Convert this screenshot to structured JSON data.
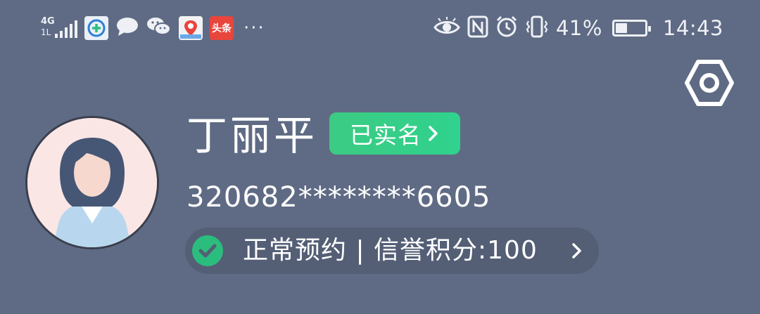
{
  "status_bar": {
    "network_type": "4G",
    "network_subtype": "1L",
    "icons_left": [
      "signal-icon",
      "health-app-icon",
      "message-icon",
      "wechat-icon",
      "maps-app-icon",
      "toutiao-app-icon"
    ],
    "toutiao_label": "头条",
    "more_indicator": "···",
    "icons_right": [
      "eye-comfort-icon",
      "nfc-icon",
      "alarm-icon",
      "vibrate-icon"
    ],
    "battery_percent": "41%",
    "battery_level": 0.41,
    "time": "14:43"
  },
  "profile": {
    "name": "丁丽平",
    "verified_label": "已实名",
    "id_number": "320682********6605",
    "status_text": "正常预约 | 信誉积分:100"
  },
  "colors": {
    "background": "#5f6b84",
    "pill_background": "#545f76",
    "verified_green": "#3ccb83",
    "check_green": "#2bbd7e",
    "avatar_bg": "#fbe6e6"
  }
}
